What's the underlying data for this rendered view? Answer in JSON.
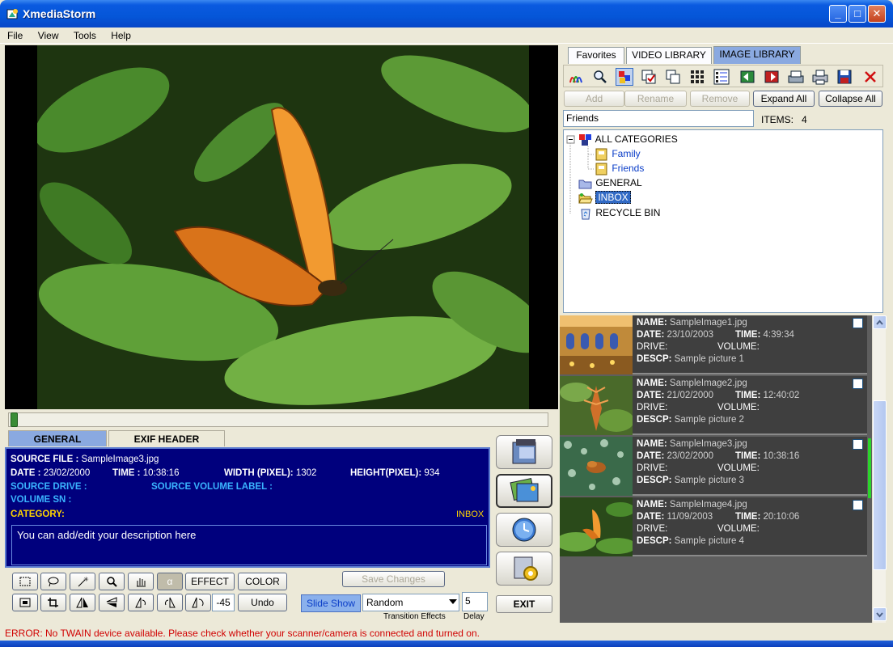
{
  "window": {
    "title": "XmediaStorm"
  },
  "menu": [
    "File",
    "View",
    "Tools",
    "Help"
  ],
  "info_tabs": [
    "GENERAL",
    "EXIF HEADER"
  ],
  "info": {
    "source_file_label": "SOURCE FILE :",
    "source_file": "SampleImage3.jpg",
    "date_label": "DATE :",
    "date": "23/02/2000",
    "time_label": "TIME :",
    "time": "10:38:16",
    "width_label": "WIDTH (PIXEL):",
    "width": "1302",
    "height_label": "HEIGHT(PIXEL):",
    "height": "934",
    "source_drive_label": "SOURCE DRIVE :",
    "source_volume_label": "SOURCE VOLUME LABEL :",
    "volume_sn_label": "VOLUME SN :",
    "category_label": "CATEGORY:",
    "category": "INBOX",
    "description": "You can add/edit your description here"
  },
  "edit_tools": {
    "effect": "EFFECT",
    "color": "COLOR",
    "rotate_value": "-45",
    "undo": "Undo",
    "save_changes": "Save Changes",
    "slide_show": "Slide Show",
    "transition_value": "Random",
    "transition_label": "Transition Effects",
    "delay_value": "5",
    "delay_label": "Delay",
    "alpha_glyph": "α",
    "exit": "EXIT"
  },
  "library_tabs": [
    "Favorites",
    "VIDEO LIBRARY",
    "IMAGE LIBRARY"
  ],
  "library_buttons": {
    "add": "Add",
    "rename": "Rename",
    "remove": "Remove",
    "expand_all": "Expand All",
    "collapse_all": "Collapse All"
  },
  "category_name_value": "Friends",
  "items_label": "ITEMS:",
  "items_count": "4",
  "tree": {
    "root": "ALL CATEGORIES",
    "children": [
      "Family",
      "Friends"
    ],
    "general": "GENERAL",
    "inbox": "INBOX",
    "recycle": "RECYCLE BIN"
  },
  "thumb_labels": {
    "name": "NAME:",
    "date": "DATE:",
    "time": "TIME:",
    "drive": "DRIVE:",
    "volume": "VOLUME:",
    "descp": "DESCP:"
  },
  "thumbnails": [
    {
      "name": "SampleImage1.jpg",
      "date": "23/10/2003",
      "time": "4:39:34",
      "descp": "Sample picture 1"
    },
    {
      "name": "SampleImage2.jpg",
      "date": "21/02/2000",
      "time": "12:40:02",
      "descp": "Sample picture 2"
    },
    {
      "name": "SampleImage3.jpg",
      "date": "23/02/2000",
      "time": "10:38:16",
      "descp": "Sample picture 3"
    },
    {
      "name": "SampleImage4.jpg",
      "date": "11/09/2003",
      "time": "20:10:06",
      "descp": "Sample picture 4"
    }
  ],
  "status": "ERROR: No TWAIN device available. Please check whether your scanner/camera is connected and turned on.",
  "colors": {
    "titlebar": "#0556d8",
    "info_panel": "#00007d",
    "tab_active": "#8aa9e0",
    "error": "#d00000"
  }
}
